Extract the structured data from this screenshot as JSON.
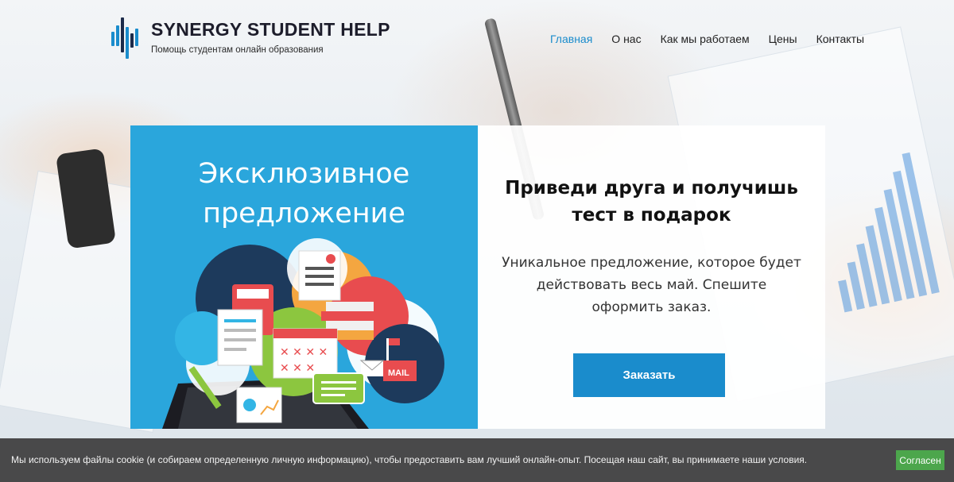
{
  "brand": {
    "title": "SYNERGY STUDENT HELP",
    "subtitle": "Помощь студентам онлайн образования",
    "accent": "#1a8ccc"
  },
  "nav": {
    "items": [
      {
        "label": "Главная",
        "active": true
      },
      {
        "label": "О нас",
        "active": false
      },
      {
        "label": "Как мы работаем",
        "active": false
      },
      {
        "label": "Цены",
        "active": false
      },
      {
        "label": "Контакты",
        "active": false
      }
    ]
  },
  "hero": {
    "left_title": "Эксклюзивное предложение",
    "heading": "Приведи друга и получишь тест в подарок",
    "description": "Уникальное предложение, которое будет действовать весь май. Спешите оформить заказ.",
    "button_label": "Заказать",
    "illustration": {
      "mail_label": "MAIL",
      "colors": {
        "panel": "#2aa6dc",
        "red": "#e84c4f",
        "orange": "#f4a640",
        "green": "#8cc63f",
        "navy": "#1d3a5c"
      }
    }
  },
  "cookie": {
    "text": "Мы используем файлы cookie (и собираем определенную личную информацию), чтобы предоставить вам лучший онлайн-опыт. Посещая наш сайт, вы принимаете наши условия.",
    "button_label": "Согласен",
    "button_color": "#4ca64c"
  }
}
